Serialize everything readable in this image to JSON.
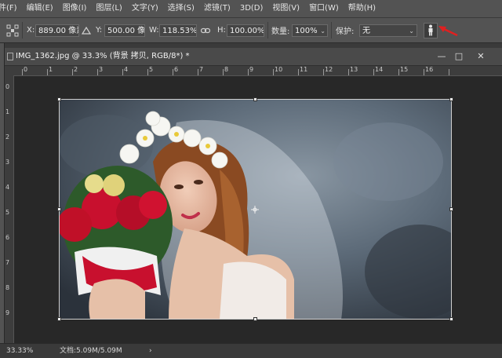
{
  "menu": [
    "件(F)",
    "编辑(E)",
    "图像(I)",
    "图层(L)",
    "文字(Y)",
    "选择(S)",
    "滤镜(T)",
    "3D(D)",
    "视图(V)",
    "窗口(W)",
    "帮助(H)"
  ],
  "options": {
    "x_label": "X:",
    "x_value": "889.00 像素",
    "y_label": "Y:",
    "y_value": "500.00 像素",
    "w_label": "W:",
    "w_value": "118.53%",
    "h_label": "H:",
    "h_value": "100.00%",
    "amount_label": "数量:",
    "amount_value": "100%",
    "protect_label": "保护:",
    "protect_value": "无"
  },
  "document": {
    "tab_title": "IMG_1362.jpg @ 33.3% (背景 拷贝, RGB/8*) *",
    "ruler_top": [
      "0",
      "1",
      "2",
      "3",
      "4",
      "5",
      "6",
      "7",
      "8",
      "9",
      "10",
      "11",
      "12",
      "13",
      "14",
      "15",
      "16"
    ],
    "ruler_left": [
      "0",
      "1",
      "2",
      "3",
      "4",
      "5",
      "6",
      "7",
      "8",
      "9"
    ]
  },
  "status": {
    "zoom": "33.33%",
    "doc_info": "文档:5.09M/5.09M"
  },
  "colors": {
    "arrow": "#e02020",
    "accent_icon": "#e6e6e6"
  }
}
